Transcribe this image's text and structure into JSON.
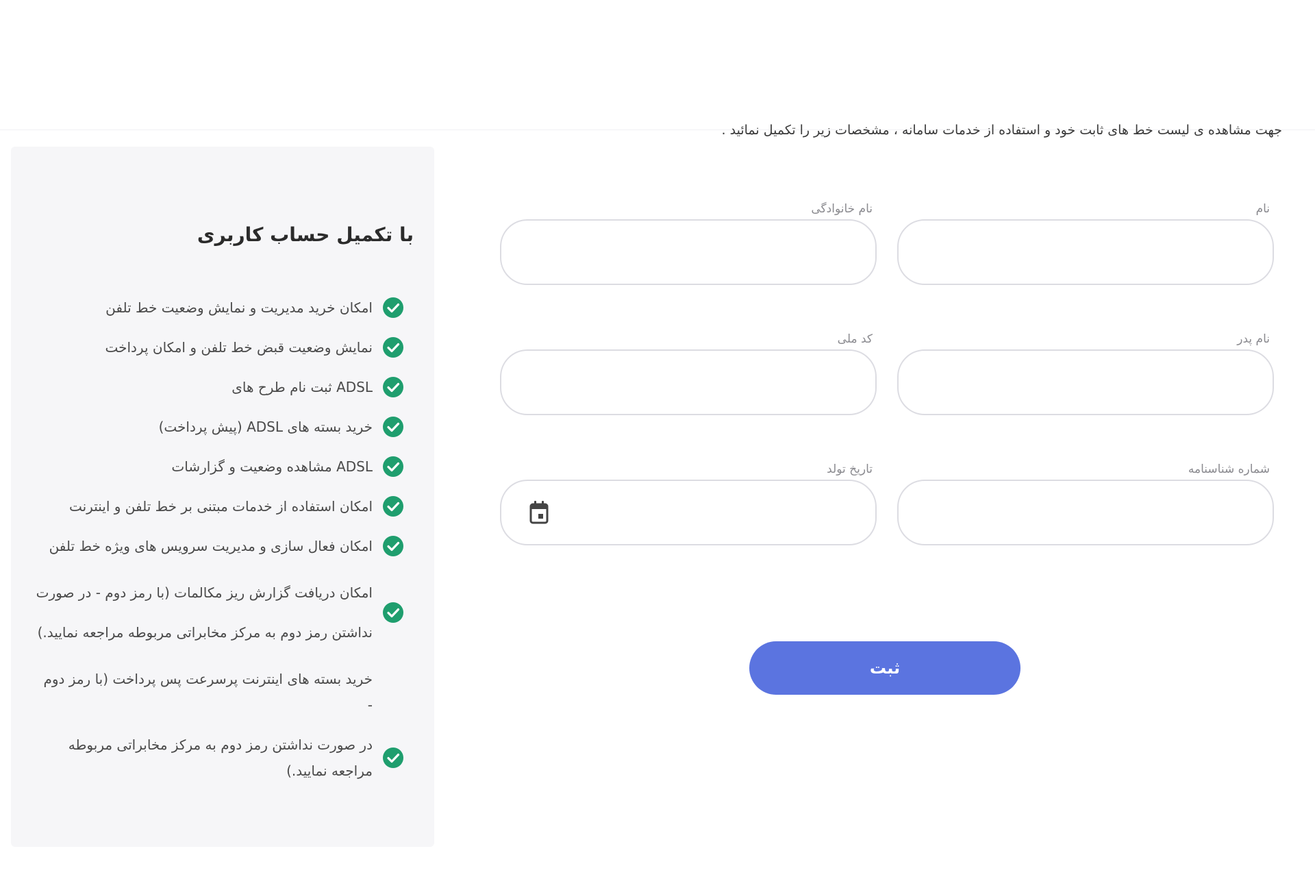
{
  "intro": {
    "text": "جهت مشاهده ی لیست خط های ثابت خود و استفاده از خدمات سامانه ، مشخصات زیر را تکمیل نمائید ."
  },
  "sidebar": {
    "title": "با تکمیل حساب کاربری",
    "benefits": [
      {
        "text": "امکان خرید مدیریت و نمایش وضعیت خط تلفن",
        "checked": true
      },
      {
        "text": "نمایش وضعیت قبض خط تلفن و امکان پرداخت",
        "checked": true
      },
      {
        "text": "ADSL ثبت نام طرح های",
        "checked": true
      },
      {
        "text": "خرید بسته های ADSL (پیش پرداخت)",
        "checked": true
      },
      {
        "text": "ADSL مشاهده وضعیت و گزارشات",
        "checked": true
      },
      {
        "text": "امکان استفاده از خدمات مبتنی بر خط تلفن و اینترنت",
        "checked": true
      },
      {
        "text": "امکان فعال سازی و مدیریت سرویس های ویژه خط تلفن",
        "checked": true
      },
      {
        "text": "امکان دریافت گزارش ریز مکالمات (با رمز دوم - در صورت نداشتن رمز دوم به مرکز مخابراتی مربوطه مراجعه نمایید.)",
        "checked": true
      },
      {
        "text": "خرید بسته های اینترنت پرسرعت پس پرداخت (با رمز دوم -",
        "checked": false
      },
      {
        "text": "در صورت نداشتن رمز دوم به مرکز مخابراتی مربوطه مراجعه نمایید.)",
        "checked": true
      }
    ]
  },
  "form": {
    "first_name_label": "نام",
    "last_name_label": "نام خانوادگی",
    "father_name_label": "نام پدر",
    "national_code_label": "کد ملی",
    "id_number_label": "شماره شناسنامه",
    "birth_date_label": "تاریخ تولد",
    "first_name_value": "",
    "last_name_value": "",
    "father_name_value": "",
    "national_code_value": "",
    "id_number_value": "",
    "birth_date_value": "",
    "submit_label": "ثبت"
  },
  "icons": {
    "check": "check-circle-icon",
    "calendar": "calendar-icon"
  },
  "colors": {
    "primary": "#5b74e0",
    "check_green": "#1f9e6e",
    "sidebar_bg": "#f6f6f8",
    "input_border": "#dcdce2"
  }
}
